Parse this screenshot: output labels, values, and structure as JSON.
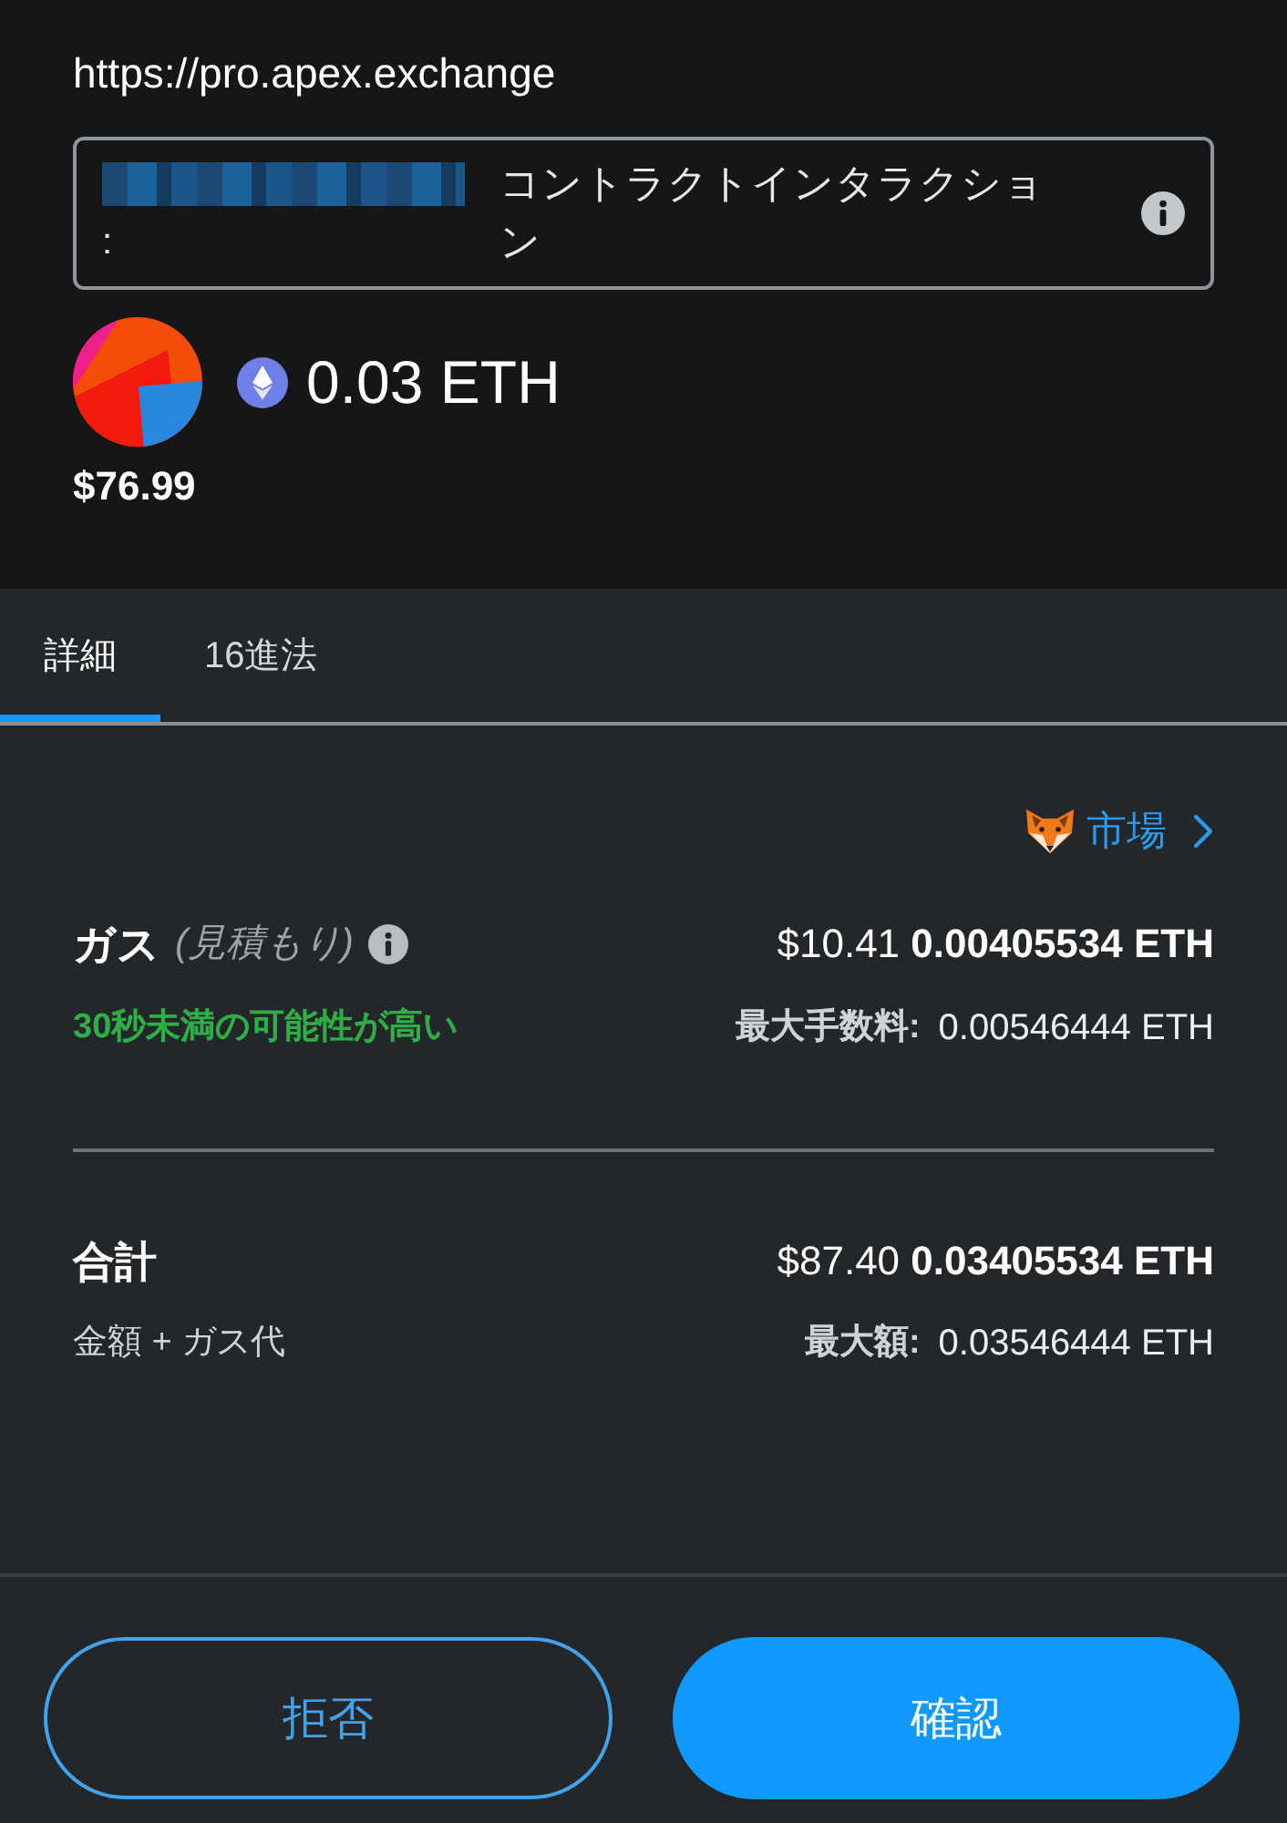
{
  "site": {
    "url": "https://pro.apex.exchange"
  },
  "interaction": {
    "address_separator": ":",
    "label": "コントラクトインタラクション"
  },
  "transfer": {
    "amount": "0.03 ETH",
    "fiat": "$76.99"
  },
  "tabs": [
    {
      "label": "詳細",
      "selected": true
    },
    {
      "label": "16進法",
      "selected": false
    }
  ],
  "market_link": {
    "label": "市場"
  },
  "gas": {
    "title": "ガス",
    "note": "(見積もり)",
    "value": "$10.41 **0.00405534 ETH**",
    "speed": "30秒未満の可能性が高い",
    "max_label": "最大手数料:",
    "max_value": "0.00546444 ETH"
  },
  "total": {
    "title": "合計",
    "subtitle": "金額 + ガス代",
    "value": "$87.40 **0.03405534 ETH**",
    "max_label": "最大額:",
    "max_value": "0.03546444 ETH"
  },
  "buttons": [
    {
      "label": "拒否",
      "kind": "secondary"
    },
    {
      "label": "確認",
      "kind": "primary"
    }
  ]
}
